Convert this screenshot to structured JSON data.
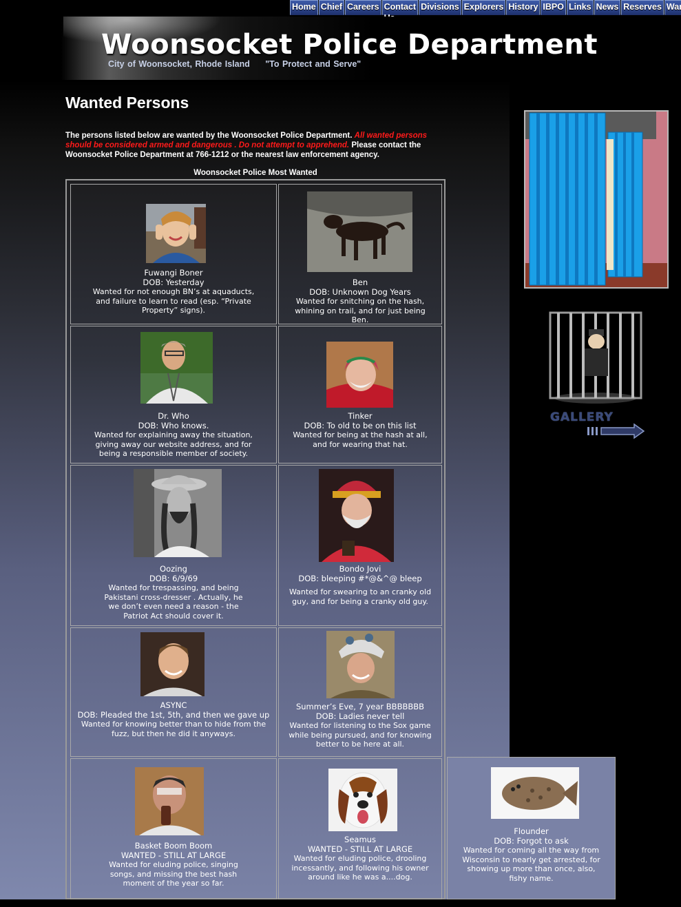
{
  "nav": [
    "Home",
    "Chief",
    "Careers",
    "Contact Us",
    "Divisions",
    "Explorers",
    "History",
    "IBPO",
    "Links",
    "News",
    "Reserves",
    "Wanted"
  ],
  "header": {
    "title": "Woonsocket Police Department",
    "subtitle": "City of Woonsocket, Rhode Island     \"To Protect and Serve\""
  },
  "page": {
    "title": "Wanted Persons",
    "intro_1": "The persons listed below are wanted by the Woonsocket Police Department.",
    "intro_warning": "All wanted persons should be considered armed and dangerous . Do not attempt to apprehend.",
    "intro_2": "Please contact the Woonsocket Police Department at 766-1212 or the nearest law enforcement agency.",
    "table_caption": "Woonsocket Police Most Wanted"
  },
  "wanted": [
    {
      "name": "Fuwangi Boner",
      "dob": "DOB: Yesterday",
      "desc": "Wanted for not enough BN’s at aquaducts, and failure to learn to read (esp. “Private Property” signs)."
    },
    {
      "name": "Ben",
      "dob": "DOB: Unknown Dog Years",
      "desc": "Wanted for snitching on the hash, whining on trail, and for just being Ben."
    },
    {
      "name": "Dr. Who",
      "dob": "DOB: Who knows.",
      "desc": "Wanted for explaining away the situation, giving away our website address, and for being a responsible member of society."
    },
    {
      "name": "Tinker",
      "dob": "DOB: To old to be on this list",
      "desc": "Wanted for being at the hash at all, and for wearing that hat."
    },
    {
      "name": "Oozing",
      "dob": "DOB: 6/9/69",
      "desc": "Wanted for trespassing, and being Pakistani cross-dresser . Actually, he we don’t even need a reason - the Patriot Act should cover it."
    },
    {
      "name": "Bondo Jovi",
      "dob": "DOB: bleeping  #*@&^@ bleep",
      "desc": "Wanted for swearing to an cranky old guy, and for being a cranky old guy."
    },
    {
      "name": "ASYNC",
      "dob": "DOB: Pleaded the 1st, 5th, and then we gave up",
      "desc": "Wanted for knowing better than to hide from the fuzz, but then he did it anyways."
    },
    {
      "name": "Summer’s Eve, 7 year BBBBBBB",
      "dob": "DOB: Ladies never tell",
      "desc": "Wanted for listening to the Sox game while being pursued, and for knowing better to be here at all."
    },
    {
      "name": "Basket Boom Boom",
      "dob": "WANTED - STILL AT LARGE",
      "desc": "Wanted for eluding police, singing songs, and missing the best hash moment of the year so far."
    },
    {
      "name": "Seamus",
      "dob": "WANTED - STILL AT LARGE",
      "desc": "Wanted for eluding police, drooling incessantly, and following his owner around like he was a....dog."
    },
    {
      "name": "Flounder",
      "dob": "DOB: Forgot to ask",
      "desc": "Wanted for coming all the way from Wisconsin to nearly get arrested, for showing up more than once, also, fishy name."
    }
  ],
  "sidebar": {
    "gallery_label": "GALLERY"
  },
  "colors": {
    "warning": "#ff1a1a",
    "nav_bg": "#2b4388",
    "accent": "#3a4a7a"
  }
}
